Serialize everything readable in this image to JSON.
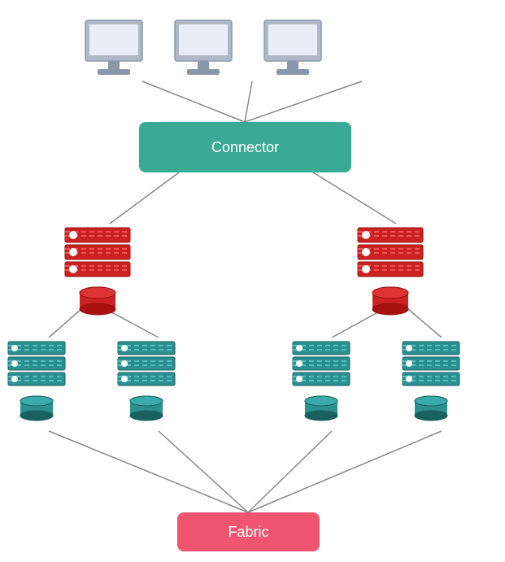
{
  "connector": {
    "label": "Connector"
  },
  "fabric": {
    "label": "Fabric"
  },
  "colors": {
    "connector_bg": "#3aaa96",
    "fabric_bg": "#f05570",
    "server_red": "#cc2222",
    "server_teal": "#2a9090",
    "line_color": "#666666"
  },
  "computers": [
    {
      "id": "computer-1"
    },
    {
      "id": "computer-2"
    },
    {
      "id": "computer-3"
    }
  ],
  "red_servers": [
    {
      "id": "red-server-left"
    },
    {
      "id": "red-server-right"
    }
  ],
  "teal_servers": [
    {
      "id": "teal-server-1"
    },
    {
      "id": "teal-server-2"
    },
    {
      "id": "teal-server-3"
    },
    {
      "id": "teal-server-4"
    }
  ]
}
